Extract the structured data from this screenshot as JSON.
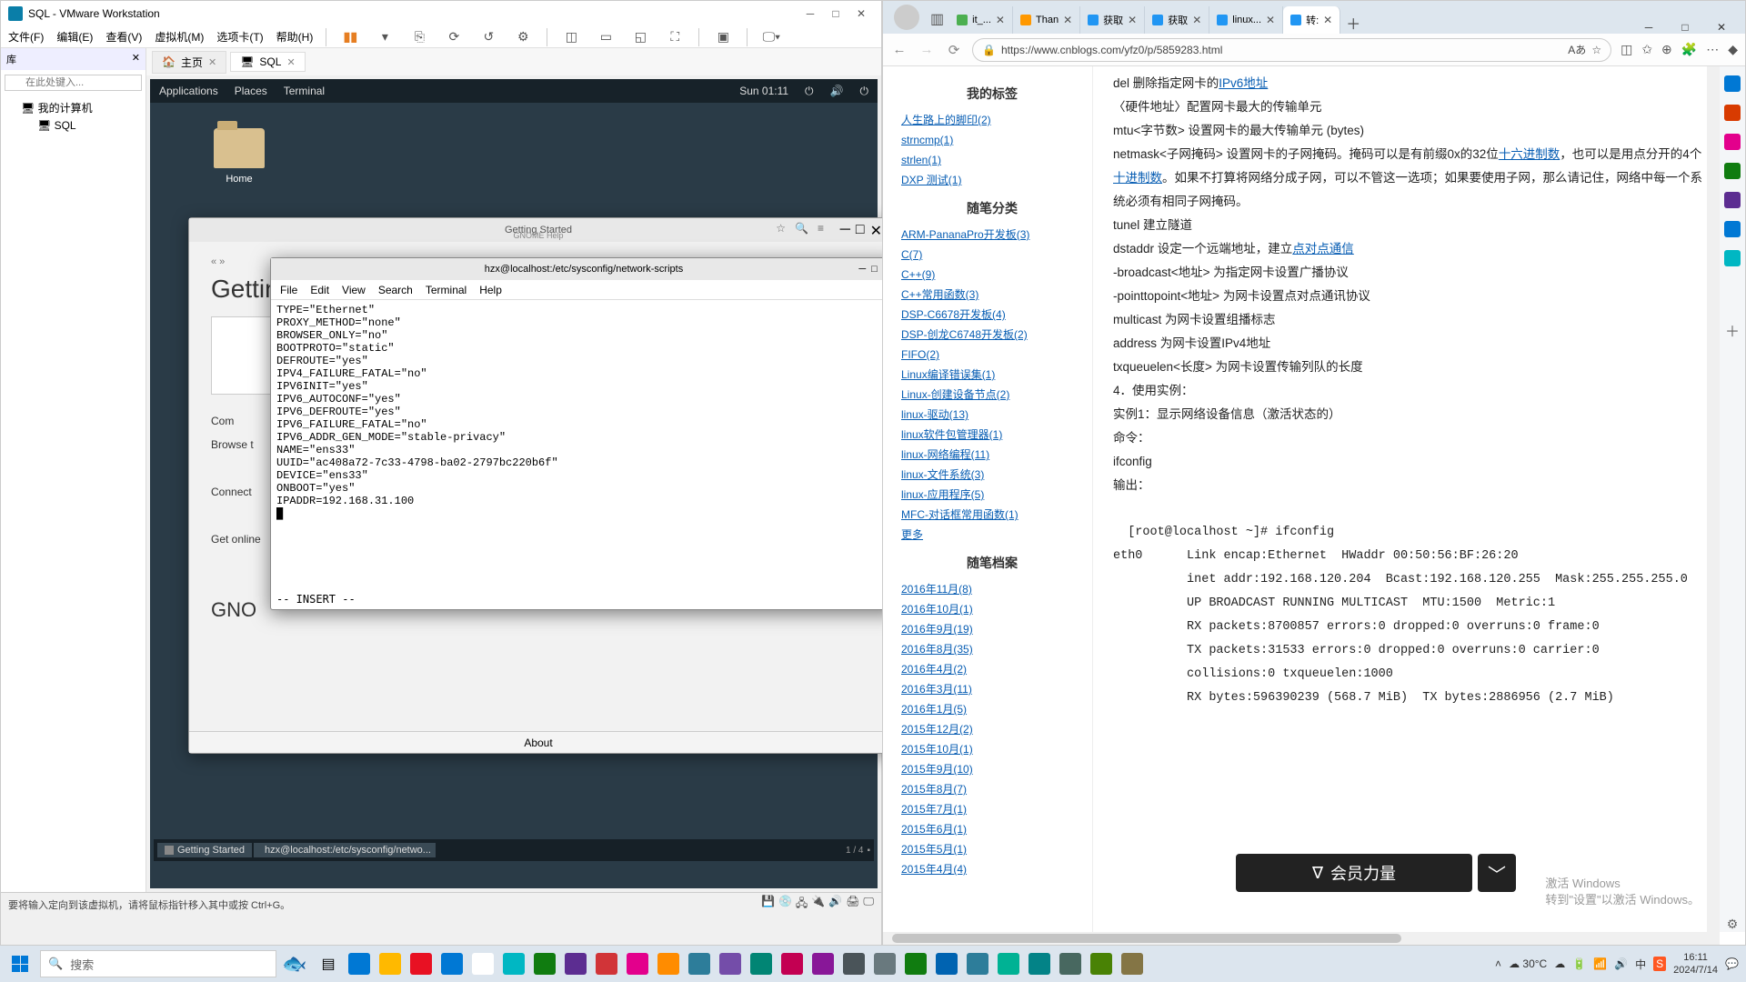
{
  "vmware": {
    "title": "SQL - VMware Workstation",
    "menu": [
      "文件(F)",
      "编辑(E)",
      "查看(V)",
      "虚拟机(M)",
      "选项卡(T)",
      "帮助(H)"
    ],
    "side": {
      "lib": "库",
      "search_ph": "在此处键入...",
      "root": "我的计算机",
      "child": "SQL"
    },
    "tabs": {
      "home": "主页",
      "active": "SQL"
    },
    "gnome": {
      "apps": "Applications",
      "places": "Places",
      "term": "Terminal",
      "clock": "Sun 01:11"
    },
    "desktop_icon": "Home",
    "help": {
      "win": "Getting Started",
      "sub": "GNOME Help",
      "title": "Getting Started",
      "crumb": "« »",
      "side_lines": [
        "Com",
        "Browse t",
        "Connect",
        "Get online",
        "GNO"
      ],
      "about": "About"
    },
    "term": {
      "title": "hzx@localhost:/etc/sysconfig/network-scripts",
      "menu": [
        "File",
        "Edit",
        "View",
        "Search",
        "Terminal",
        "Help"
      ],
      "body": "TYPE=\"Ethernet\"\nPROXY_METHOD=\"none\"\nBROWSER_ONLY=\"no\"\nBOOTPROTO=\"static\"\nDEFROUTE=\"yes\"\nIPV4_FAILURE_FATAL=\"no\"\nIPV6INIT=\"yes\"\nIPV6_AUTOCONF=\"yes\"\nIPV6_DEFROUTE=\"yes\"\nIPV6_FAILURE_FATAL=\"no\"\nIPV6_ADDR_GEN_MODE=\"stable-privacy\"\nNAME=\"ens33\"\nUUID=\"ac408a72-7c33-4798-ba02-2797bc220b6f\"\nDEVICE=\"ens33\"\nONBOOT=\"yes\"\nIPADDR=192.168.31.100\n█",
      "status": "-- INSERT --"
    },
    "tasks": [
      "Getting Started",
      "hzx@localhost:/etc/sysconfig/netwo..."
    ],
    "pager": "1 / 4",
    "status": "要将输入定向到该虚拟机，请将鼠标指针移入其中或按 Ctrl+G。"
  },
  "edge": {
    "tabs": [
      {
        "label": "it_...",
        "fav": "#4caf50"
      },
      {
        "label": "Than",
        "fav": "#ff9800"
      },
      {
        "label": "获取",
        "fav": "#2196f3"
      },
      {
        "label": "获取",
        "fav": "#2196f3"
      },
      {
        "label": "linux...",
        "fav": "#2196f3"
      },
      {
        "label": "转:",
        "fav": "#2196f3",
        "active": true
      }
    ],
    "url": "https://www.cnblogs.com/yfz0/p/5859283.html",
    "sidebar": {
      "sec1": "我的标签",
      "tags": [
        "人生路上的脚印(2)",
        "strncmp(1)",
        "strlen(1)",
        "DXP 测试(1)"
      ],
      "sec2": "随笔分类",
      "cats": [
        "ARM-PananaPro开发板(3)",
        "C(7)",
        "C++(9)",
        "C++常用函数(3)",
        "DSP-C6678开发板(4)",
        "DSP-创龙C6748开发板(2)",
        "FIFO(2)",
        "Linux编译错误集(1)",
        "Linux-创建设备节点(2)",
        "linux-驱动(13)",
        "linux软件包管理器(1)",
        "linux-网络编程(11)",
        "linux-文件系统(3)",
        "linux-应用程序(5)",
        "MFC-对话框常用函数(1)",
        "更多"
      ],
      "sec3": "随笔档案",
      "arch": [
        "2016年11月(8)",
        "2016年10月(1)",
        "2016年9月(19)",
        "2016年8月(35)",
        "2016年4月(2)",
        "2016年3月(11)",
        "2016年1月(5)",
        "2015年12月(2)",
        "2015年10月(1)",
        "2015年9月(10)",
        "2015年8月(7)",
        "2015年7月(1)",
        "2015年6月(1)",
        "2015年5月(1)",
        "2015年4月(4)"
      ]
    },
    "article": {
      "lines": [
        {
          "t": "    del 删除指定网卡的",
          "u": "IPv6地址"
        },
        {
          "t": "  〈硬件地址〉配置网卡最大的传输单元"
        },
        {
          "t": "   mtu<字节数> 设置网卡的最大传输单元 (bytes)"
        },
        {
          "t": "   netmask<子网掩码> 设置网卡的子网掩码。掩码可以是有前缀0x的32位",
          "u": "十六进制数",
          "t2": "，也可以是用点分开的4个",
          "u2": "十进制数",
          "t3": "。如果不打算将网络分成子网，可以不管这一选项；如果要使用子网，那么请记住，网络中每一个系统必须有相同子网掩码。"
        },
        {
          "t": "   tunel 建立隧道"
        },
        {
          "t": "   dstaddr 设定一个远端地址，建立",
          "u": "点对点通信"
        },
        {
          "t": "   -broadcast<地址> 为指定网卡设置广播协议"
        },
        {
          "t": "   -pointtopoint<地址> 为网卡设置点对点通讯协议"
        },
        {
          "t": "   multicast 为网卡设置组播标志"
        },
        {
          "t": "   address 为网卡设置IPv4地址"
        },
        {
          "t": "   txqueuelen<长度> 为网卡设置传输列队的长度"
        },
        {
          "t": "   4．使用实例："
        },
        {
          "t": "   实例1：显示网络设备信息（激活状态的）"
        },
        {
          "t": "   命令："
        },
        {
          "t": "   ifconfig"
        },
        {
          "t": "   输出："
        },
        {
          "t": ""
        },
        {
          "t": "  [root@localhost ~]# ifconfig",
          "mono": true
        },
        {
          "t": "eth0      Link encap:Ethernet  HWaddr 00:50:56:BF:26:20",
          "mono": true
        },
        {
          "t": "          inet addr:192.168.120.204  Bcast:192.168.120.255  Mask:255.255.255.0",
          "mono": true
        },
        {
          "t": "          UP BROADCAST RUNNING MULTICAST  MTU:1500  Metric:1",
          "mono": true
        },
        {
          "t": "          RX packets:8700857 errors:0 dropped:0 overruns:0 frame:0",
          "mono": true
        },
        {
          "t": "          TX packets:31533 errors:0 dropped:0 overruns:0 carrier:0",
          "mono": true
        },
        {
          "t": "          collisions:0 txqueuelen:1000",
          "mono": true
        },
        {
          "t": "          RX bytes:596390239 (568.7 MiB)  TX bytes:2886956 (2.7 MiB)",
          "mono": true
        }
      ]
    },
    "banner": "会员力量",
    "activate1": "激活 Windows",
    "activate2": "转到\"设置\"以激活 Windows。"
  },
  "taskbar": {
    "search": "搜索",
    "weather": "30°C",
    "time": "16:11",
    "date": "2024/7/14"
  }
}
